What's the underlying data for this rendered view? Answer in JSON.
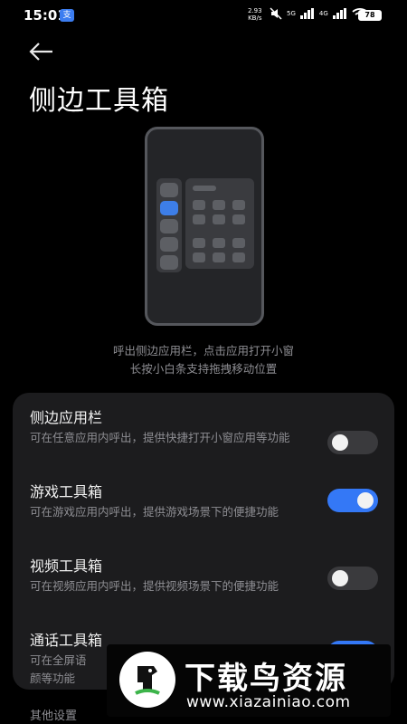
{
  "status_bar": {
    "time": "15:01",
    "app_badge": "支",
    "net_speed_value": "2.93",
    "net_speed_unit": "KB/s",
    "signal_1": "5G",
    "signal_2": "4G",
    "battery": "78"
  },
  "header": {
    "title": "侧边工具箱"
  },
  "illustration": {
    "description_line1": "呼出侧边应用栏，点击应用打开小窗",
    "description_line2": "长按小白条支持拖拽移动位置"
  },
  "settings": {
    "items": [
      {
        "name": "侧边应用栏",
        "desc": "可在任意应用内呼出，提供快捷打开小窗应用等功能",
        "enabled": false
      },
      {
        "name": "游戏工具箱",
        "desc": "可在游戏应用内呼出，提供游戏场景下的便捷功能",
        "enabled": true
      },
      {
        "name": "视频工具箱",
        "desc": "可在视频应用内呼出，提供视频场景下的便捷功能",
        "enabled": false
      },
      {
        "name": "通话工具箱",
        "desc": "可在全屏语",
        "desc2": "颜等功能",
        "enabled": true
      }
    ]
  },
  "footer": {
    "other_settings": "其他设置"
  },
  "watermark": {
    "brand": "下载鸟资源",
    "url": "www.xiazainiao.com"
  },
  "colors": {
    "accent": "#3478f6",
    "background": "#000000",
    "card": "#1c1c1e"
  }
}
